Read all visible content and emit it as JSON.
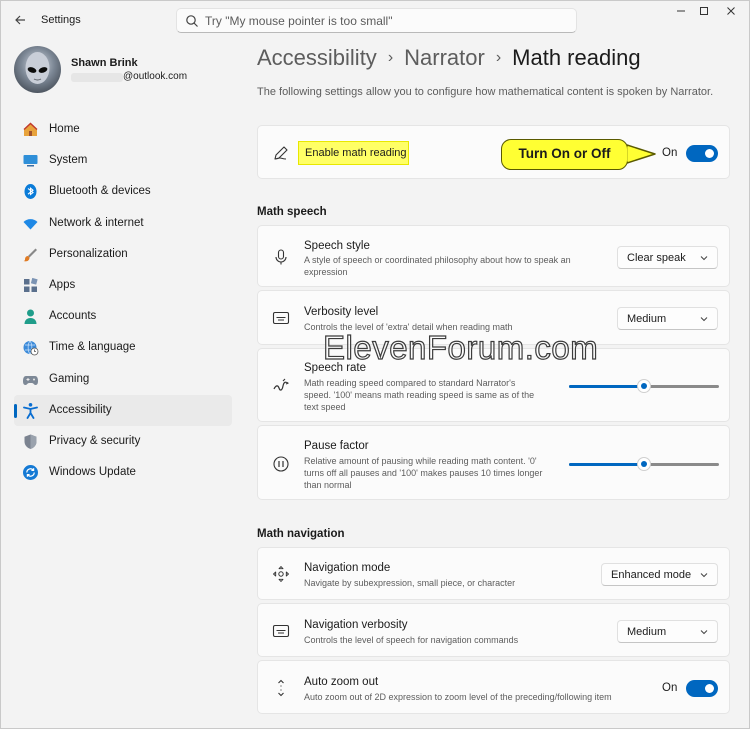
{
  "window": {
    "title": "Settings",
    "back_icon": "back-arrow-icon",
    "controls": [
      "minimize-icon",
      "maximize-icon",
      "close-icon"
    ]
  },
  "search": {
    "placeholder": "Try \"My mouse pointer is too small\""
  },
  "profile": {
    "name": "Shawn Brink",
    "email_suffix": "@outlook.com"
  },
  "sidebar": {
    "items": [
      {
        "label": "Home",
        "icon": "home-icon",
        "active": false
      },
      {
        "label": "System",
        "icon": "monitor-icon",
        "active": false
      },
      {
        "label": "Bluetooth & devices",
        "icon": "bluetooth-icon",
        "active": false
      },
      {
        "label": "Network & internet",
        "icon": "wifi-icon",
        "active": false
      },
      {
        "label": "Personalization",
        "icon": "brush-icon",
        "active": false
      },
      {
        "label": "Apps",
        "icon": "apps-icon",
        "active": false
      },
      {
        "label": "Accounts",
        "icon": "person-icon",
        "active": false
      },
      {
        "label": "Time & language",
        "icon": "globe-clock-icon",
        "active": false
      },
      {
        "label": "Gaming",
        "icon": "gamepad-icon",
        "active": false
      },
      {
        "label": "Accessibility",
        "icon": "accessibility-icon",
        "active": true
      },
      {
        "label": "Privacy & security",
        "icon": "shield-icon",
        "active": false
      },
      {
        "label": "Windows Update",
        "icon": "update-icon",
        "active": false
      }
    ]
  },
  "breadcrumb": {
    "items": [
      "Accessibility",
      "Narrator",
      "Math reading"
    ],
    "separator": "›"
  },
  "description": "The following settings allow you to configure how mathematical content is spoken by Narrator.",
  "enable_card": {
    "title": "Enable math reading",
    "toggle_label": "On",
    "toggle_on": true,
    "icon": "pen-icon"
  },
  "callout": {
    "text": "Turn On or Off"
  },
  "math_speech": {
    "title": "Math speech",
    "speech_style": {
      "title": "Speech style",
      "desc_line1": "A style of speech or coordinated philosophy about how to speak an",
      "desc_line2": "expression",
      "value": "Clear speak",
      "icon": "microphone-icon"
    },
    "verbosity": {
      "title": "Verbosity level",
      "desc_line1": "Controls the level of 'extra' detail when reading math",
      "value": "Medium",
      "icon": "verbosity-icon"
    },
    "speech_rate": {
      "title": "Speech rate",
      "desc_line1": "Math reading speed compared to standard Narrator's",
      "desc_line2": "speed. '100' means math reading speed is same as of the",
      "desc_line3": "text speed",
      "slider_fraction": 0.5,
      "icon": "speech-rate-icon"
    },
    "pause_factor": {
      "title": "Pause factor",
      "desc_line1": "Relative amount of pausing while reading math content. '0'",
      "desc_line2": "turns off all pauses and '100' makes pauses 10 times longer",
      "desc_line3": "than normal",
      "slider_fraction": 0.5,
      "icon": "pause-icon"
    }
  },
  "math_navigation": {
    "title": "Math navigation",
    "navigation_mode": {
      "title": "Navigation mode",
      "desc_line1": "Navigate by subexpression, small piece, or character",
      "value": "Enhanced mode",
      "icon": "navigation-icon"
    },
    "navigation_verbosity": {
      "title": "Navigation verbosity",
      "desc_line1": "Controls the level of speech for navigation commands",
      "value": "Medium",
      "icon": "verbosity-icon"
    },
    "auto_zoom": {
      "title": "Auto zoom out",
      "desc_line1": "Auto zoom out of 2D expression to zoom level of the preceding/following item",
      "toggle_label": "On",
      "toggle_on": true,
      "icon": "zoom-out-icon"
    }
  },
  "watermark": "ElevenForum.com",
  "colors": {
    "accent": "#0067c0",
    "highlight": "#ffff66",
    "callout": "#ffff33"
  }
}
